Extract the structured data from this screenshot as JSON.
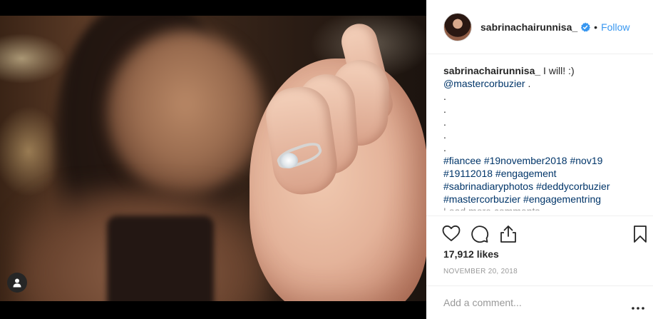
{
  "post": {
    "username": "sabrinachairunnisa_",
    "follow_label": "Follow",
    "dot_separator": "•",
    "caption": {
      "author": "sabrinachairunnisa_",
      "text": " I will! :)",
      "mention": "@mastercorbuzier",
      "mention_suffix": " .",
      "dots": [
        ".",
        ".",
        ".",
        ".",
        "."
      ],
      "hashtag_lines": [
        "#fiancee #19november2018 #nov19",
        "#19112018 #engagement",
        "#sabrinadiaryphotos #deddycorbuzier",
        "#mastercorbuzier #engagementring"
      ]
    },
    "load_more": "Load more comments",
    "likes": "17,912 likes",
    "date": "NOVEMBER 20, 2018",
    "comment_placeholder": "Add a comment...",
    "icons": {
      "like": "heart-icon",
      "comment": "comment-icon",
      "share": "share-icon",
      "save": "bookmark-icon",
      "verified": "verified-badge-icon",
      "tag": "user-tag-icon",
      "more": "more-options-icon"
    },
    "colors": {
      "link": "#3897f0",
      "hashtag": "#003569",
      "muted": "#999999",
      "text": "#262626"
    }
  }
}
